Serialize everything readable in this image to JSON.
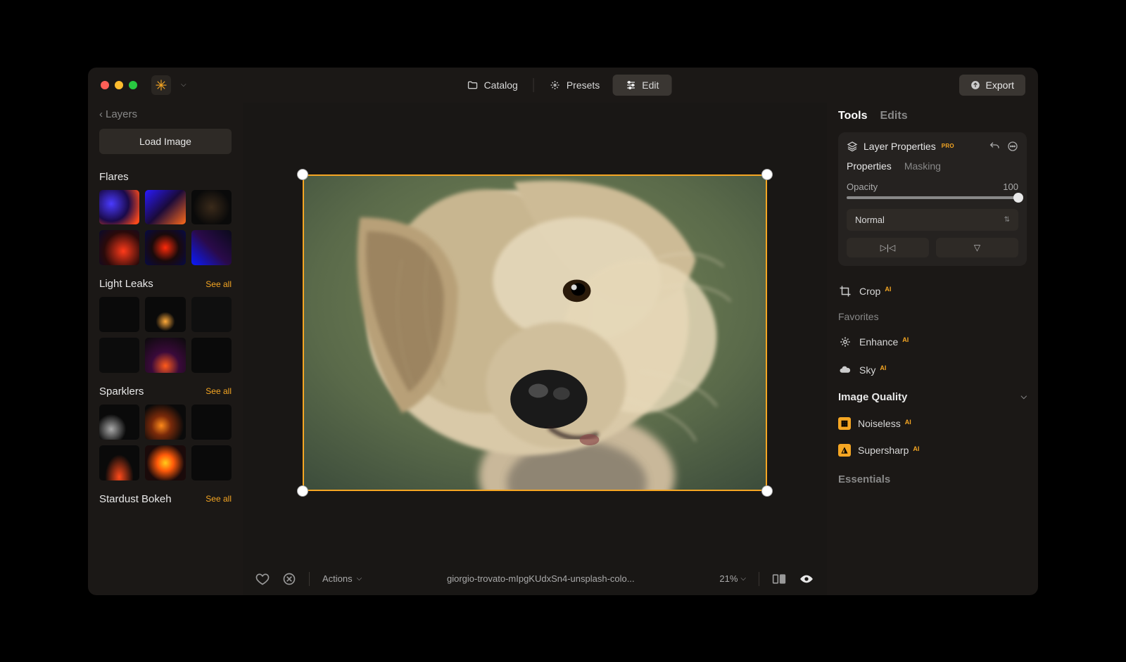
{
  "titlebar": {
    "tabs": {
      "catalog": "Catalog",
      "presets": "Presets",
      "edit": "Edit"
    },
    "export": "Export"
  },
  "sidebar": {
    "back": "Layers",
    "load": "Load Image",
    "categories": [
      {
        "title": "Flares",
        "see_all": ""
      },
      {
        "title": "Light Leaks",
        "see_all": "See all"
      },
      {
        "title": "Sparklers",
        "see_all": "See all"
      },
      {
        "title": "Stardust Bokeh",
        "see_all": "See all"
      }
    ]
  },
  "bottombar": {
    "actions": "Actions",
    "filename": "giorgio-trovato-mIpgKUdxSn4-unsplash-colo...",
    "zoom": "21%"
  },
  "rightpanel": {
    "tabs": {
      "tools": "Tools",
      "edits": "Edits"
    },
    "layer_properties": {
      "title": "Layer Properties",
      "pro": "PRO",
      "sub_tabs": {
        "properties": "Properties",
        "masking": "Masking"
      },
      "opacity_label": "Opacity",
      "opacity_value": "100",
      "blend_mode": "Normal"
    },
    "crop": "Crop",
    "favorites": "Favorites",
    "enhance": "Enhance",
    "sky": "Sky",
    "image_quality": "Image Quality",
    "noiseless": "Noiseless",
    "supersharp": "Supersharp",
    "essentials": "Essentials",
    "ai": "AI"
  }
}
